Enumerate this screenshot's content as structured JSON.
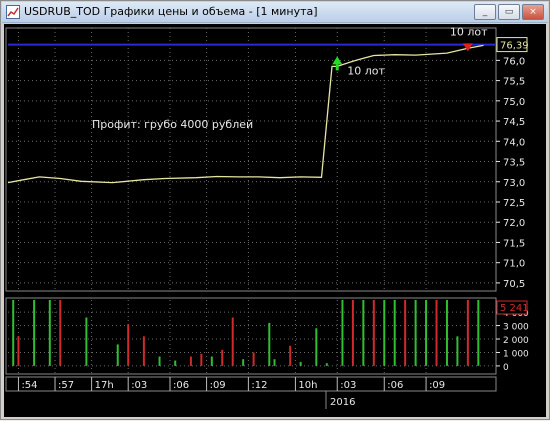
{
  "window": {
    "title": "USDRUB_TOD Графики цены и объема - [1 минута]",
    "buttons": {
      "minimize": "_",
      "restore": "▭",
      "close": "×"
    }
  },
  "colors": {
    "background": "#000000",
    "price_line": "#e6e6a0",
    "grid": "#6a6a6a",
    "current_level": "#2b2bd6",
    "buy_marker": "#22dd22",
    "sell_marker": "#e02020",
    "volume_up": "#2fbf2f",
    "volume_down": "#d02a2a",
    "axis_text": "#e8e8e8"
  },
  "annotations": {
    "profit_text": "Профит: грубо  4000 рублей",
    "buy_label": "10 лот",
    "sell_label": "10 лот"
  },
  "chart_data": [
    {
      "type": "line",
      "title": "USDRUB_TOD",
      "ylim": [
        70.3,
        76.8
      ],
      "y_ticks": [
        "76,0",
        "75,5",
        "75,0",
        "74,5",
        "74,0",
        "73,5",
        "73,0",
        "72,5",
        "72,0",
        "71,5",
        "71,0",
        "70,5"
      ],
      "y_tick_values": [
        76.0,
        75.5,
        75.0,
        74.5,
        74.0,
        73.5,
        73.0,
        72.5,
        72.0,
        71.5,
        71.0,
        70.5
      ],
      "current_value_label": "76,39",
      "current_value": 76.39,
      "x": [
        0,
        3,
        6,
        10,
        14,
        20,
        26,
        30,
        36,
        40,
        44,
        48,
        52,
        56,
        60,
        62,
        63,
        66,
        68,
        70,
        74,
        78,
        84,
        88,
        91
      ],
      "y": [
        72.98,
        73.05,
        73.12,
        73.08,
        73.01,
        72.98,
        73.05,
        73.08,
        73.1,
        73.13,
        73.12,
        73.12,
        73.1,
        73.12,
        73.11,
        75.85,
        75.85,
        75.98,
        76.05,
        76.12,
        76.14,
        76.13,
        76.18,
        76.3,
        76.37
      ],
      "markers": [
        {
          "type": "buy",
          "x": 63,
          "y": 75.95,
          "label": "10 лот"
        },
        {
          "type": "sell",
          "x": 88,
          "y": 76.32,
          "label": "10 лот"
        }
      ]
    },
    {
      "type": "bar",
      "title": "Volume",
      "ylim": [
        -600,
        4900
      ],
      "y_ticks": [
        "4 000",
        "3 000",
        "2 000",
        "1 000",
        "0"
      ],
      "y_tick_values": [
        4000,
        3000,
        2000,
        1000,
        0
      ],
      "current_value_label": "5 241",
      "current_value": 5241,
      "x_labels": [
        ":54",
        ":57",
        "17h",
        ":03",
        ":06",
        ":09",
        ":12",
        "10h",
        ":03",
        ":06",
        ":09"
      ],
      "date_label": "2016",
      "bars": [
        {
          "x": 1,
          "v": 4900,
          "dir": "up"
        },
        {
          "x": 2,
          "v": 2200,
          "dir": "down"
        },
        {
          "x": 5,
          "v": 4900,
          "dir": "up"
        },
        {
          "x": 8,
          "v": 4900,
          "dir": "up"
        },
        {
          "x": 10,
          "v": 4900,
          "dir": "down"
        },
        {
          "x": 15,
          "v": 3600,
          "dir": "up"
        },
        {
          "x": 21,
          "v": 1600,
          "dir": "up"
        },
        {
          "x": 23,
          "v": 3100,
          "dir": "down"
        },
        {
          "x": 26,
          "v": 2200,
          "dir": "down"
        },
        {
          "x": 29,
          "v": 700,
          "dir": "up"
        },
        {
          "x": 32,
          "v": 400,
          "dir": "up"
        },
        {
          "x": 35,
          "v": 700,
          "dir": "down"
        },
        {
          "x": 37,
          "v": 900,
          "dir": "down"
        },
        {
          "x": 39,
          "v": 700,
          "dir": "up"
        },
        {
          "x": 41,
          "v": 1200,
          "dir": "down"
        },
        {
          "x": 43,
          "v": 3600,
          "dir": "down"
        },
        {
          "x": 45,
          "v": 500,
          "dir": "up"
        },
        {
          "x": 47,
          "v": 1000,
          "dir": "down"
        },
        {
          "x": 50,
          "v": 3200,
          "dir": "up"
        },
        {
          "x": 51,
          "v": 500,
          "dir": "up"
        },
        {
          "x": 54,
          "v": 1500,
          "dir": "down"
        },
        {
          "x": 56,
          "v": 300,
          "dir": "up"
        },
        {
          "x": 59,
          "v": 2800,
          "dir": "up"
        },
        {
          "x": 61,
          "v": 200,
          "dir": "up"
        },
        {
          "x": 64,
          "v": 4900,
          "dir": "up"
        },
        {
          "x": 66,
          "v": 4900,
          "dir": "down"
        },
        {
          "x": 68,
          "v": 4900,
          "dir": "up"
        },
        {
          "x": 70,
          "v": 4900,
          "dir": "down"
        },
        {
          "x": 72,
          "v": 4900,
          "dir": "up"
        },
        {
          "x": 74,
          "v": 4900,
          "dir": "up"
        },
        {
          "x": 76,
          "v": 4900,
          "dir": "down"
        },
        {
          "x": 78,
          "v": 4900,
          "dir": "up"
        },
        {
          "x": 80,
          "v": 4900,
          "dir": "up"
        },
        {
          "x": 82,
          "v": 4900,
          "dir": "down"
        },
        {
          "x": 84,
          "v": 4900,
          "dir": "up"
        },
        {
          "x": 86,
          "v": 2200,
          "dir": "up"
        },
        {
          "x": 88,
          "v": 4900,
          "dir": "down"
        },
        {
          "x": 90,
          "v": 4900,
          "dir": "up"
        }
      ]
    }
  ]
}
